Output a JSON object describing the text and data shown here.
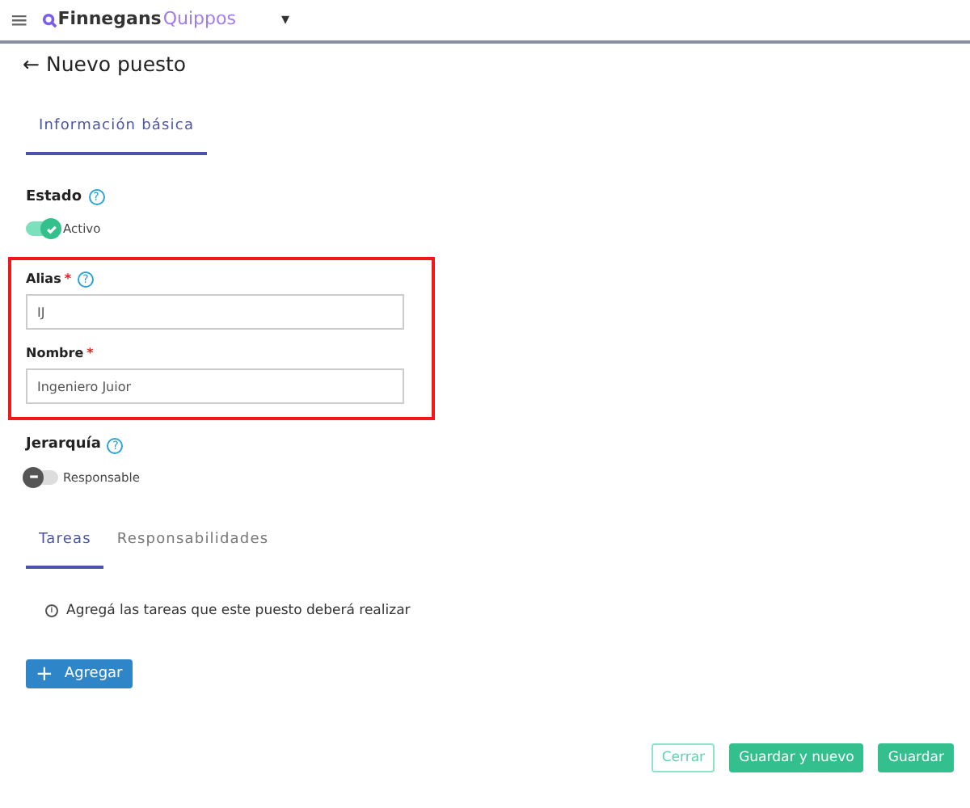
{
  "header": {
    "menu": "≡",
    "brand": "Finnegans",
    "product": "Quippos",
    "caret": "▾"
  },
  "page": {
    "back": "←",
    "title": "Nuevo puesto"
  },
  "main_tabs": [
    {
      "label": "Información básica",
      "selected": true
    }
  ],
  "estado": {
    "label": "Estado",
    "help": "?",
    "on": true,
    "text": "Activo"
  },
  "fields": [
    {
      "label": "Alias",
      "required": "*",
      "help": true,
      "value": "IJ"
    },
    {
      "label": "Nombre",
      "required": "*",
      "help": false,
      "value": "Ingeniero Juior"
    }
  ],
  "jerarquia": {
    "label": "Jerarquía",
    "help": "?",
    "on": false,
    "text": "Responsable"
  },
  "sub_tabs": [
    {
      "label": "Tareas",
      "selected": true
    },
    {
      "label": "Responsabilidades",
      "selected": false
    }
  ],
  "info": {
    "icon": "i",
    "text": "Agregá las tareas que este puesto deberá realizar"
  },
  "add_button": {
    "icon": "+",
    "label": "Agregar"
  },
  "footer": [
    {
      "kind": "outline",
      "label": "Cerrar"
    },
    {
      "kind": "solid",
      "label": "Guardar y nuevo"
    },
    {
      "kind": "solid",
      "label": "Guardar"
    }
  ]
}
